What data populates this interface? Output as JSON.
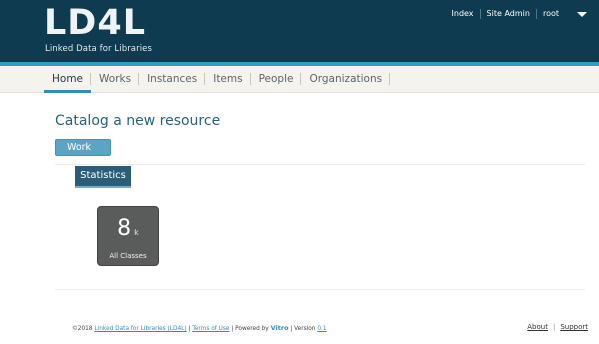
{
  "header": {
    "logo_text": "LD4L",
    "tagline": "Linked Data for Libraries",
    "links": [
      "Index",
      "Site Admin"
    ],
    "user": "root",
    "colors": {
      "bar": "#0e3b4f",
      "accent": "#2e9ec4"
    }
  },
  "nav": {
    "items": [
      "Home",
      "Works",
      "Instances",
      "Items",
      "People",
      "Organizations"
    ],
    "active": "Home"
  },
  "main": {
    "title": "Catalog a new resource",
    "work_button": "Work",
    "stats_tab": "Statistics",
    "stat": {
      "value": "8",
      "unit": "k",
      "label": "All Classes"
    }
  },
  "footer": {
    "copyright": "©2018",
    "org_link": "Linked Data for Libraries (LD4L)",
    "sep1": " | ",
    "terms": "Terms of Use",
    "sep2": " | Powered by ",
    "vitro": "Vitro",
    "sep3": " | Version ",
    "version": "0.1",
    "about": "About",
    "support": "Support",
    "pipe": "|"
  }
}
